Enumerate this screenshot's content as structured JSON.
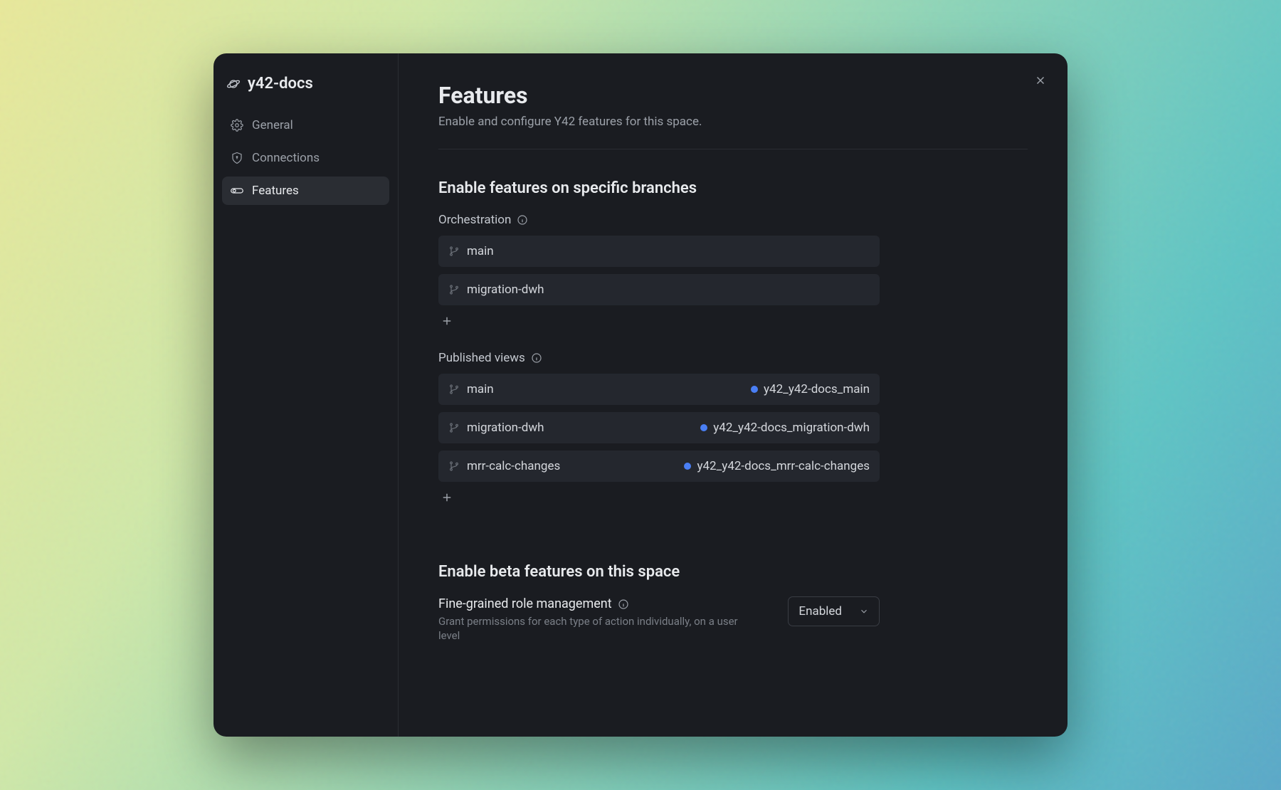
{
  "brand": {
    "title": "y42-docs"
  },
  "sidebar": {
    "items": [
      {
        "label": "General"
      },
      {
        "label": "Connections"
      },
      {
        "label": "Features"
      }
    ]
  },
  "header": {
    "title": "Features",
    "subtitle": "Enable and configure Y42 features for this space."
  },
  "branches_section": {
    "title": "Enable features on specific branches",
    "orchestration": {
      "label": "Orchestration",
      "items": [
        {
          "name": "main"
        },
        {
          "name": "migration-dwh"
        }
      ]
    },
    "published_views": {
      "label": "Published views",
      "items": [
        {
          "name": "main",
          "target": "y42_y42-docs_main"
        },
        {
          "name": "migration-dwh",
          "target": "y42_y42-docs_migration-dwh"
        },
        {
          "name": "mrr-calc-changes",
          "target": "y42_y42-docs_mrr-calc-changes"
        }
      ]
    }
  },
  "beta_section": {
    "title": "Enable beta features on this space",
    "feature": {
      "title": "Fine-grained role management",
      "desc": "Grant permissions for each type of action individually, on a user level",
      "status": "Enabled"
    }
  }
}
